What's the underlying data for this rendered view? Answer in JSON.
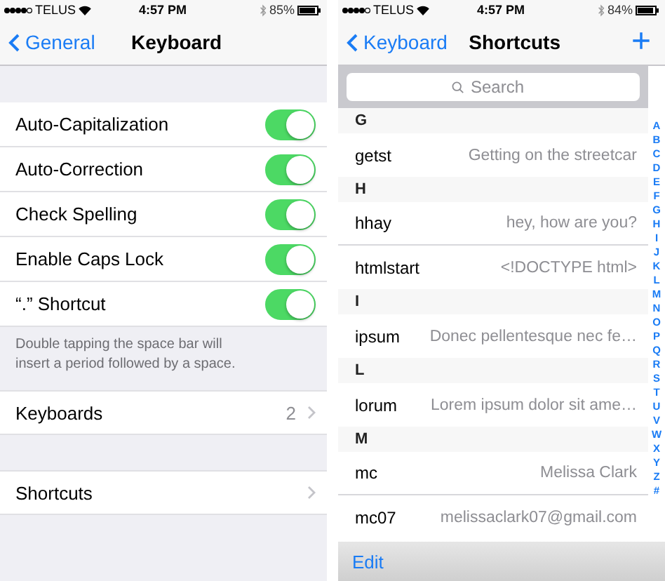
{
  "left": {
    "status": {
      "carrier": "TELUS",
      "time": "4:57 PM",
      "battery": "85%"
    },
    "nav": {
      "back": "General",
      "title": "Keyboard"
    },
    "toggles": [
      {
        "label": "Auto-Capitalization",
        "on": true
      },
      {
        "label": "Auto-Correction",
        "on": true
      },
      {
        "label": "Check Spelling",
        "on": true
      },
      {
        "label": "Enable Caps Lock",
        "on": true
      },
      {
        "label": "“.” Shortcut",
        "on": true
      }
    ],
    "footer": "Double tapping the space bar will insert a period followed by a space.",
    "links": [
      {
        "label": "Keyboards",
        "value": "2"
      },
      {
        "label": "Shortcuts"
      }
    ]
  },
  "right": {
    "status": {
      "carrier": "TELUS",
      "time": "4:57 PM",
      "battery": "84%"
    },
    "nav": {
      "back": "Keyboard",
      "title": "Shortcuts",
      "action": "+"
    },
    "search": {
      "placeholder": "Search"
    },
    "sections": [
      {
        "header": "G",
        "items": [
          {
            "shortcut": "getst",
            "phrase": "Getting on the streetcar"
          }
        ]
      },
      {
        "header": "H",
        "items": [
          {
            "shortcut": "hhay",
            "phrase": "hey, how are you?"
          },
          {
            "shortcut": "htmlstart",
            "phrase": "<!DOCTYPE html>"
          }
        ]
      },
      {
        "header": "I",
        "items": [
          {
            "shortcut": "ipsum",
            "phrase": "Donec pellentesque nec fe…"
          }
        ]
      },
      {
        "header": "L",
        "items": [
          {
            "shortcut": "lorum",
            "phrase": "Lorem ipsum dolor sit ame…"
          }
        ]
      },
      {
        "header": "M",
        "items": [
          {
            "shortcut": "mc",
            "phrase": "Melissa Clark"
          },
          {
            "shortcut": "mc07",
            "phrase": "melissaclark07@gmail.com"
          }
        ]
      }
    ],
    "index": [
      "A",
      "B",
      "C",
      "D",
      "E",
      "F",
      "G",
      "H",
      "I",
      "J",
      "K",
      "L",
      "M",
      "N",
      "O",
      "P",
      "Q",
      "R",
      "S",
      "T",
      "U",
      "V",
      "W",
      "X",
      "Y",
      "Z",
      "#"
    ],
    "toolbar": {
      "edit": "Edit"
    }
  }
}
